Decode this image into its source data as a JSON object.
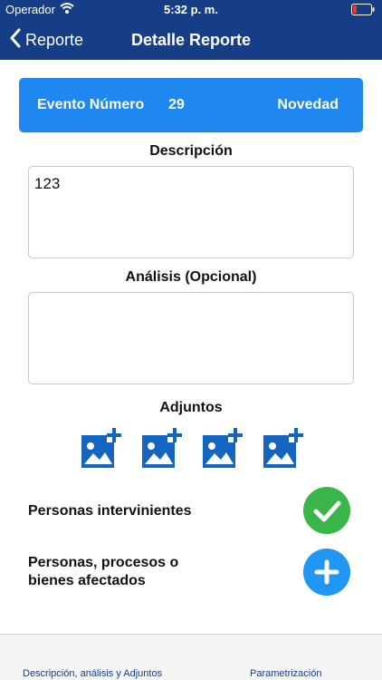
{
  "status_bar": {
    "carrier": "Operador",
    "time": "5:32 p. m.",
    "wifi_icon": "wifi-icon",
    "battery_icon": "battery-icon"
  },
  "nav": {
    "back_label": "Reporte",
    "title": "Detalle Reporte"
  },
  "event": {
    "label": "Evento Número",
    "number": "29",
    "type": "Novedad",
    "color": "#1e88f0"
  },
  "description": {
    "title": "Descripción",
    "value": "123"
  },
  "analysis": {
    "title": "Análisis (Opcional)",
    "value": ""
  },
  "attachments": {
    "title": "Adjuntos",
    "icons": [
      "add-image-icon",
      "add-image-icon",
      "add-image-icon",
      "add-image-icon"
    ]
  },
  "rows": [
    {
      "label": "Personas intervinientes",
      "status": "completed",
      "icon": "check-icon",
      "color": "#39b54a"
    },
    {
      "label": "Personas, procesos o bienes afectados",
      "label_line1": "Personas, procesos o",
      "label_line2": "bienes afectados",
      "status": "add",
      "icon": "plus-icon",
      "color": "#2196f3"
    }
  ],
  "tabs": [
    {
      "label": "Descripción, análisis y Adjuntos"
    },
    {
      "label": "Parametrización"
    }
  ],
  "colors": {
    "navbar": "#163e86",
    "accent": "#1e88f0",
    "icon_blue": "#1565c0"
  }
}
